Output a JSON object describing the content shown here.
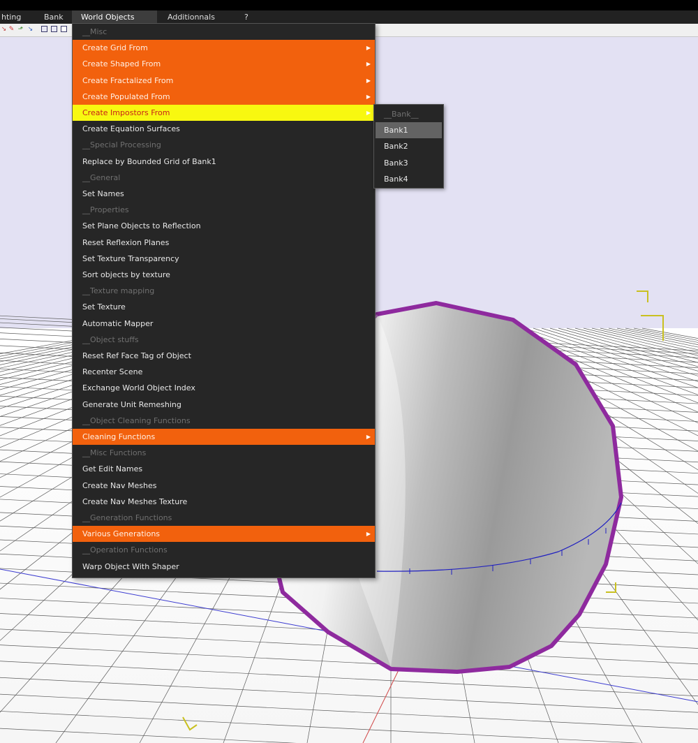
{
  "menubar": {
    "items": [
      {
        "label": "hting"
      },
      {
        "label": "Bank"
      },
      {
        "label": "World Objects"
      },
      {
        "label": "Additionnals"
      },
      {
        "label": "?"
      }
    ]
  },
  "toolbar": {
    "icons": [
      "move-tool-icon",
      "paint-tool-icon",
      "select-tool-icon",
      "scale-tool-icon",
      "copy-view-icon",
      "cube-view-icon",
      "wire-cube-icon"
    ]
  },
  "dropdown": {
    "items": [
      {
        "label": "__Misc",
        "kind": "separator"
      },
      {
        "label": "Create Grid From",
        "kind": "submenu",
        "style": "orange"
      },
      {
        "label": "Create Shaped From",
        "kind": "submenu",
        "style": "orange"
      },
      {
        "label": "Create Fractalized From",
        "kind": "submenu",
        "style": "orange"
      },
      {
        "label": "Create Populated From",
        "kind": "submenu",
        "style": "orange"
      },
      {
        "label": "Create Impostors From",
        "kind": "submenu",
        "style": "yellow"
      },
      {
        "label": "Create Equation Surfaces",
        "kind": "item"
      },
      {
        "label": "__Special Processing",
        "kind": "separator"
      },
      {
        "label": "Replace by Bounded Grid of Bank1",
        "kind": "item"
      },
      {
        "label": "__General",
        "kind": "separator"
      },
      {
        "label": "Set Names",
        "kind": "item"
      },
      {
        "label": "__Properties",
        "kind": "separator"
      },
      {
        "label": "Set Plane Objects to Reflection",
        "kind": "item"
      },
      {
        "label": "Reset Reflexion Planes",
        "kind": "item"
      },
      {
        "label": "Set Texture Transparency",
        "kind": "item"
      },
      {
        "label": "Sort objects by texture",
        "kind": "item"
      },
      {
        "label": "__Texture mapping",
        "kind": "separator"
      },
      {
        "label": "Set Texture",
        "kind": "item"
      },
      {
        "label": "Automatic Mapper",
        "kind": "item"
      },
      {
        "label": "__Object stuffs",
        "kind": "separator"
      },
      {
        "label": "Reset Ref Face Tag of Object",
        "kind": "item"
      },
      {
        "label": "Recenter Scene",
        "kind": "item"
      },
      {
        "label": "Exchange World Object Index",
        "kind": "item"
      },
      {
        "label": "Generate Unit Remeshing",
        "kind": "item"
      },
      {
        "label": "__Object Cleaning Functions",
        "kind": "separator"
      },
      {
        "label": "Cleaning Functions",
        "kind": "submenu",
        "style": "orange"
      },
      {
        "label": "__Misc Functions",
        "kind": "separator"
      },
      {
        "label": "Get Edit Names",
        "kind": "item"
      },
      {
        "label": "Create Nav Meshes",
        "kind": "item"
      },
      {
        "label": "Create Nav Meshes Texture",
        "kind": "item"
      },
      {
        "label": "__Generation Functions",
        "kind": "separator"
      },
      {
        "label": "Various Generations",
        "kind": "submenu",
        "style": "orange"
      },
      {
        "label": "__Operation Functions",
        "kind": "separator"
      },
      {
        "label": "Warp Object With Shaper",
        "kind": "item"
      }
    ],
    "submenu_arrow": "▶"
  },
  "submenu": {
    "items": [
      {
        "label": "__Bank__",
        "kind": "separator"
      },
      {
        "label": "Bank1",
        "kind": "item",
        "highlighted": true
      },
      {
        "label": "Bank2",
        "kind": "item"
      },
      {
        "label": "Bank3",
        "kind": "item"
      },
      {
        "label": "Bank4",
        "kind": "item"
      }
    ]
  },
  "colors": {
    "menu_bg": "#262626",
    "orange_highlight": "#f2610d",
    "yellow_highlight": "#f8f810",
    "viewport_bg": "#e3e1f3",
    "sphere_outline": "#8e2a9e"
  }
}
